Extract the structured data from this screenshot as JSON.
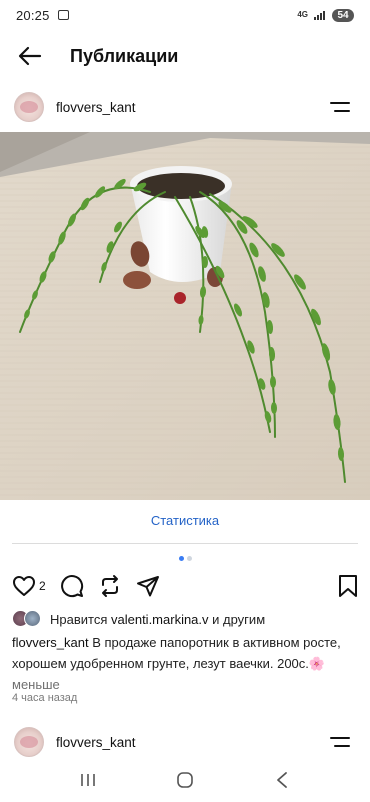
{
  "status": {
    "time": "20:25",
    "network": "4G",
    "battery": "54"
  },
  "header": {
    "title": "Публикации"
  },
  "post": {
    "username": "flovvers_kant",
    "stats_link": "Статистика",
    "like_count": "2",
    "likes_prefix": "Нравится ",
    "liked_by": "valenti.markina.v",
    "likes_suffix": " и другим",
    "caption_user": "flovvers_kant",
    "caption_text": " В продаже папоротник в активном росте, хорошем удобренном грунте, лезут ваечки. 200с.",
    "caption_emoji": "🌸",
    "caption_less": " меньше",
    "time_ago": "4 часа назад",
    "carousel": {
      "count": 2,
      "active": 0
    }
  },
  "next_post": {
    "username": "flovvers_kant"
  },
  "icons": {
    "back": "arrow-left-icon",
    "menu": "menu-icon",
    "like": "heart-icon",
    "comment": "comment-icon",
    "repost": "repost-icon",
    "share": "send-icon",
    "save": "bookmark-icon",
    "nav_recent": "recent-apps-icon",
    "nav_home": "home-icon",
    "nav_back": "nav-back-icon"
  },
  "colors": {
    "link": "#2463c7",
    "active_dot": "#3a7cf3",
    "inactive_dot": "#cfd6df"
  }
}
